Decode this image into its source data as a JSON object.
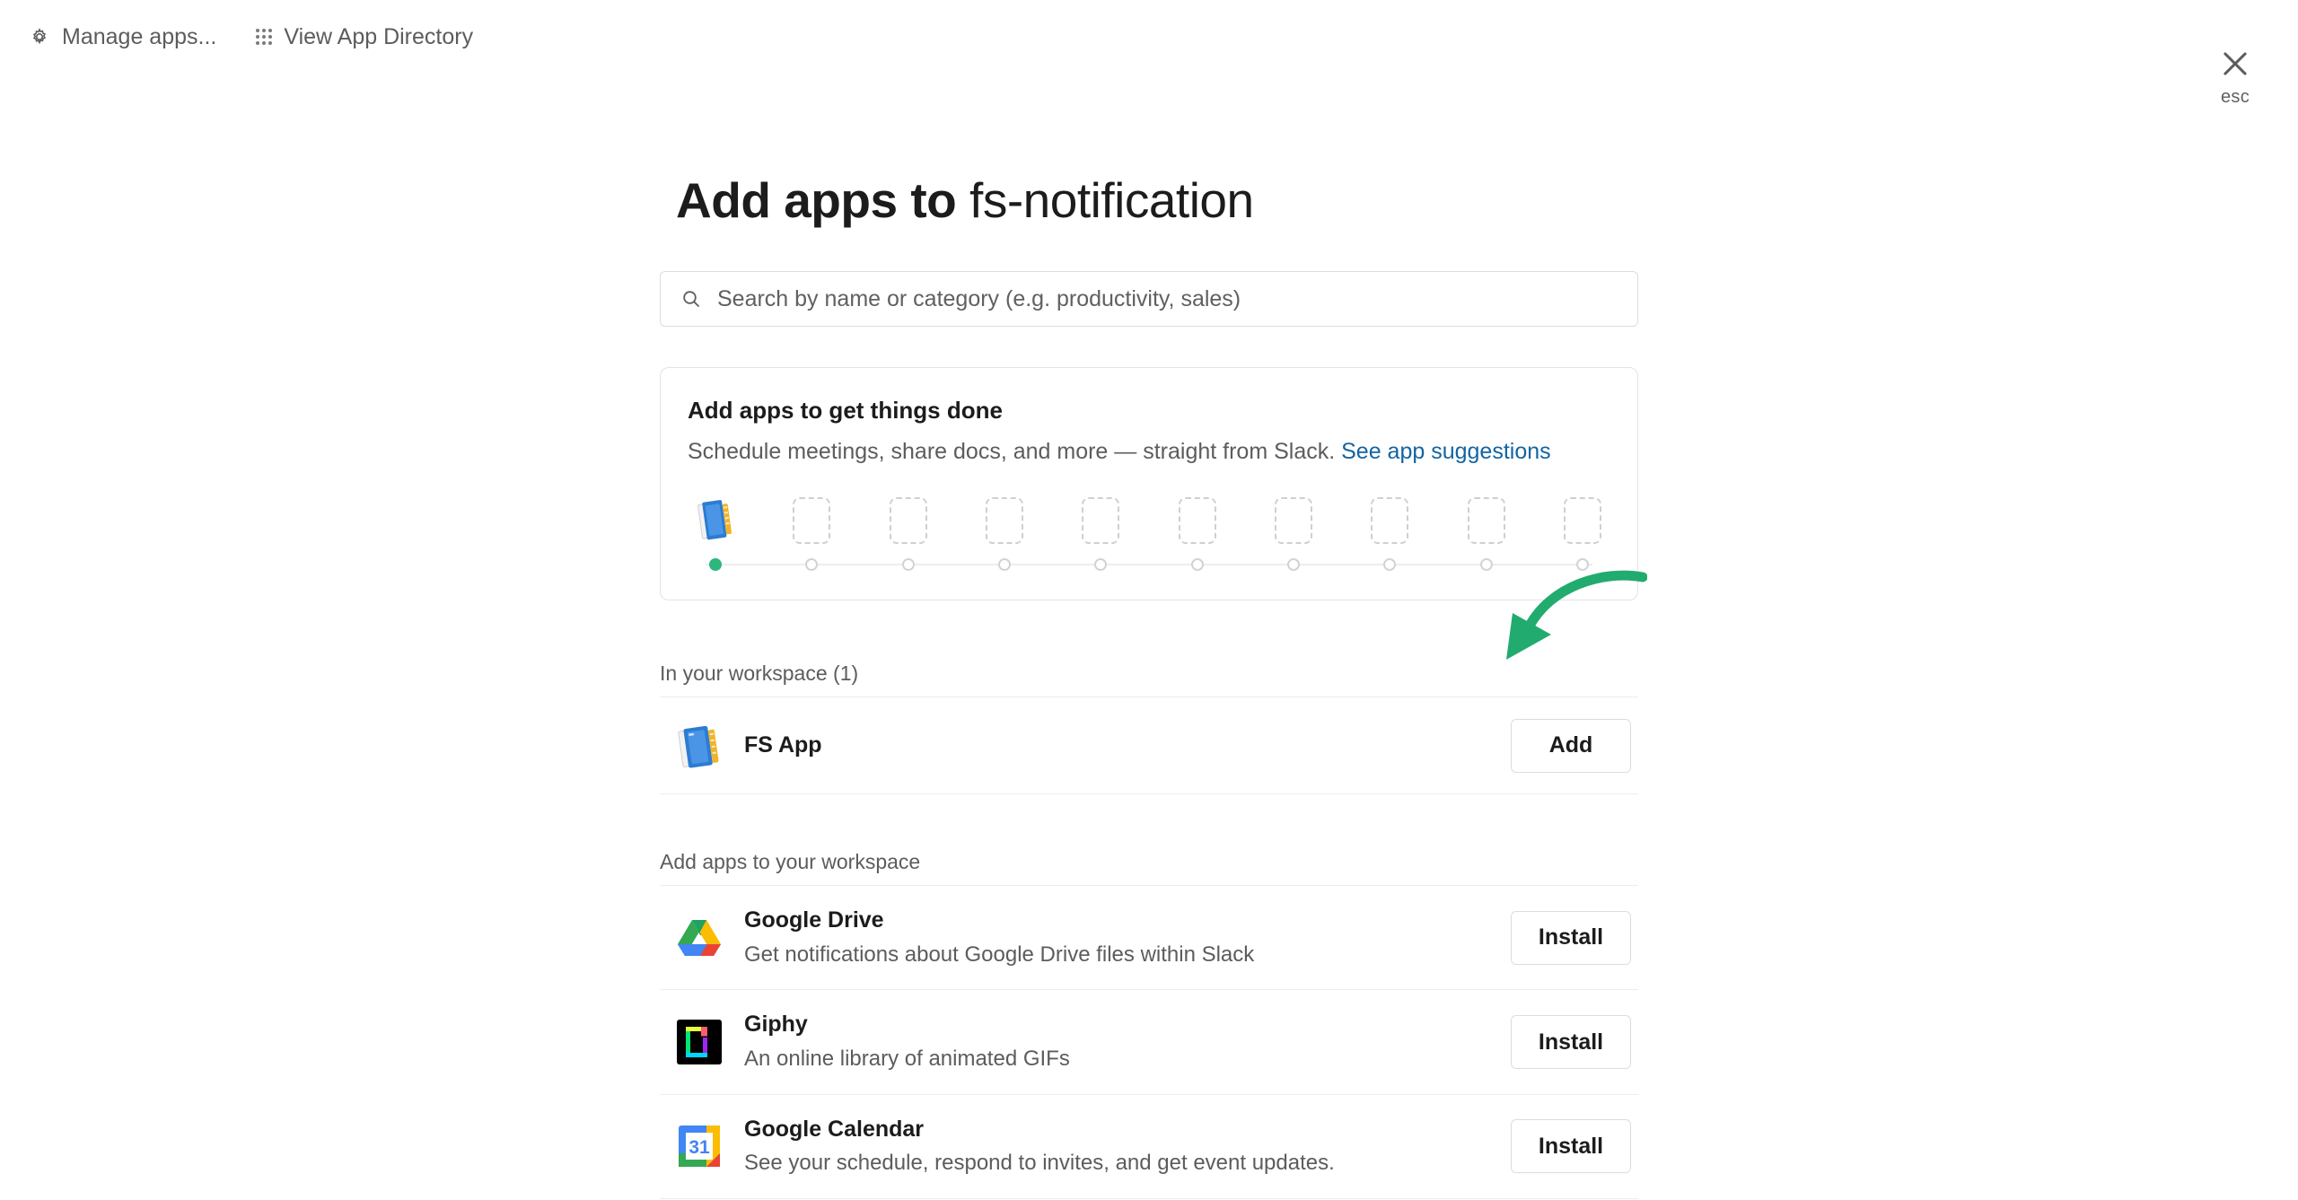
{
  "topbar": {
    "links": [
      {
        "label": "Manage apps...",
        "icon": "gear-icon"
      },
      {
        "label": "View App Directory",
        "icon": "grid-dots-icon"
      }
    ]
  },
  "close": {
    "icon": "close-icon",
    "label": "esc"
  },
  "header": {
    "title_prefix": "Add apps to",
    "workspace_name": "fs-notification"
  },
  "search": {
    "placeholder": "Search by name or category (e.g. productivity, sales)",
    "value": "",
    "icon": "search-icon"
  },
  "promo": {
    "title": "Add apps to get things done",
    "subtitle": "Schedule meetings, share docs, and more — straight from Slack.",
    "link_label": "See app suggestions",
    "stepper": {
      "total_slots": 10,
      "filled_slots": 1,
      "filled_app": "FS App"
    }
  },
  "workspace_section": {
    "label": "In your workspace (1)",
    "count": 1,
    "apps": [
      {
        "name": "FS App",
        "description": "",
        "button_label": "Add",
        "icon": "fs-app-icon"
      }
    ]
  },
  "suggested_section": {
    "label": "Add apps to your workspace",
    "apps": [
      {
        "name": "Google Drive",
        "description": "Get notifications about Google Drive files within Slack",
        "button_label": "Install",
        "icon": "google-drive-icon"
      },
      {
        "name": "Giphy",
        "description": "An online library of animated GIFs",
        "button_label": "Install",
        "icon": "giphy-icon"
      },
      {
        "name": "Google Calendar",
        "description": "See your schedule, respond to invites, and get event updates.",
        "button_label": "Install",
        "icon": "google-calendar-icon"
      }
    ]
  },
  "annotation": {
    "type": "curved-arrow",
    "color": "#22ab6e",
    "points_to": "Add"
  },
  "colors": {
    "accent_link": "#1264a3",
    "stepper_active": "#2eb67d",
    "annotation_green": "#22ab6e",
    "text_primary": "#1d1c1d",
    "text_secondary": "#5c5c5e",
    "border": "#ededee"
  }
}
